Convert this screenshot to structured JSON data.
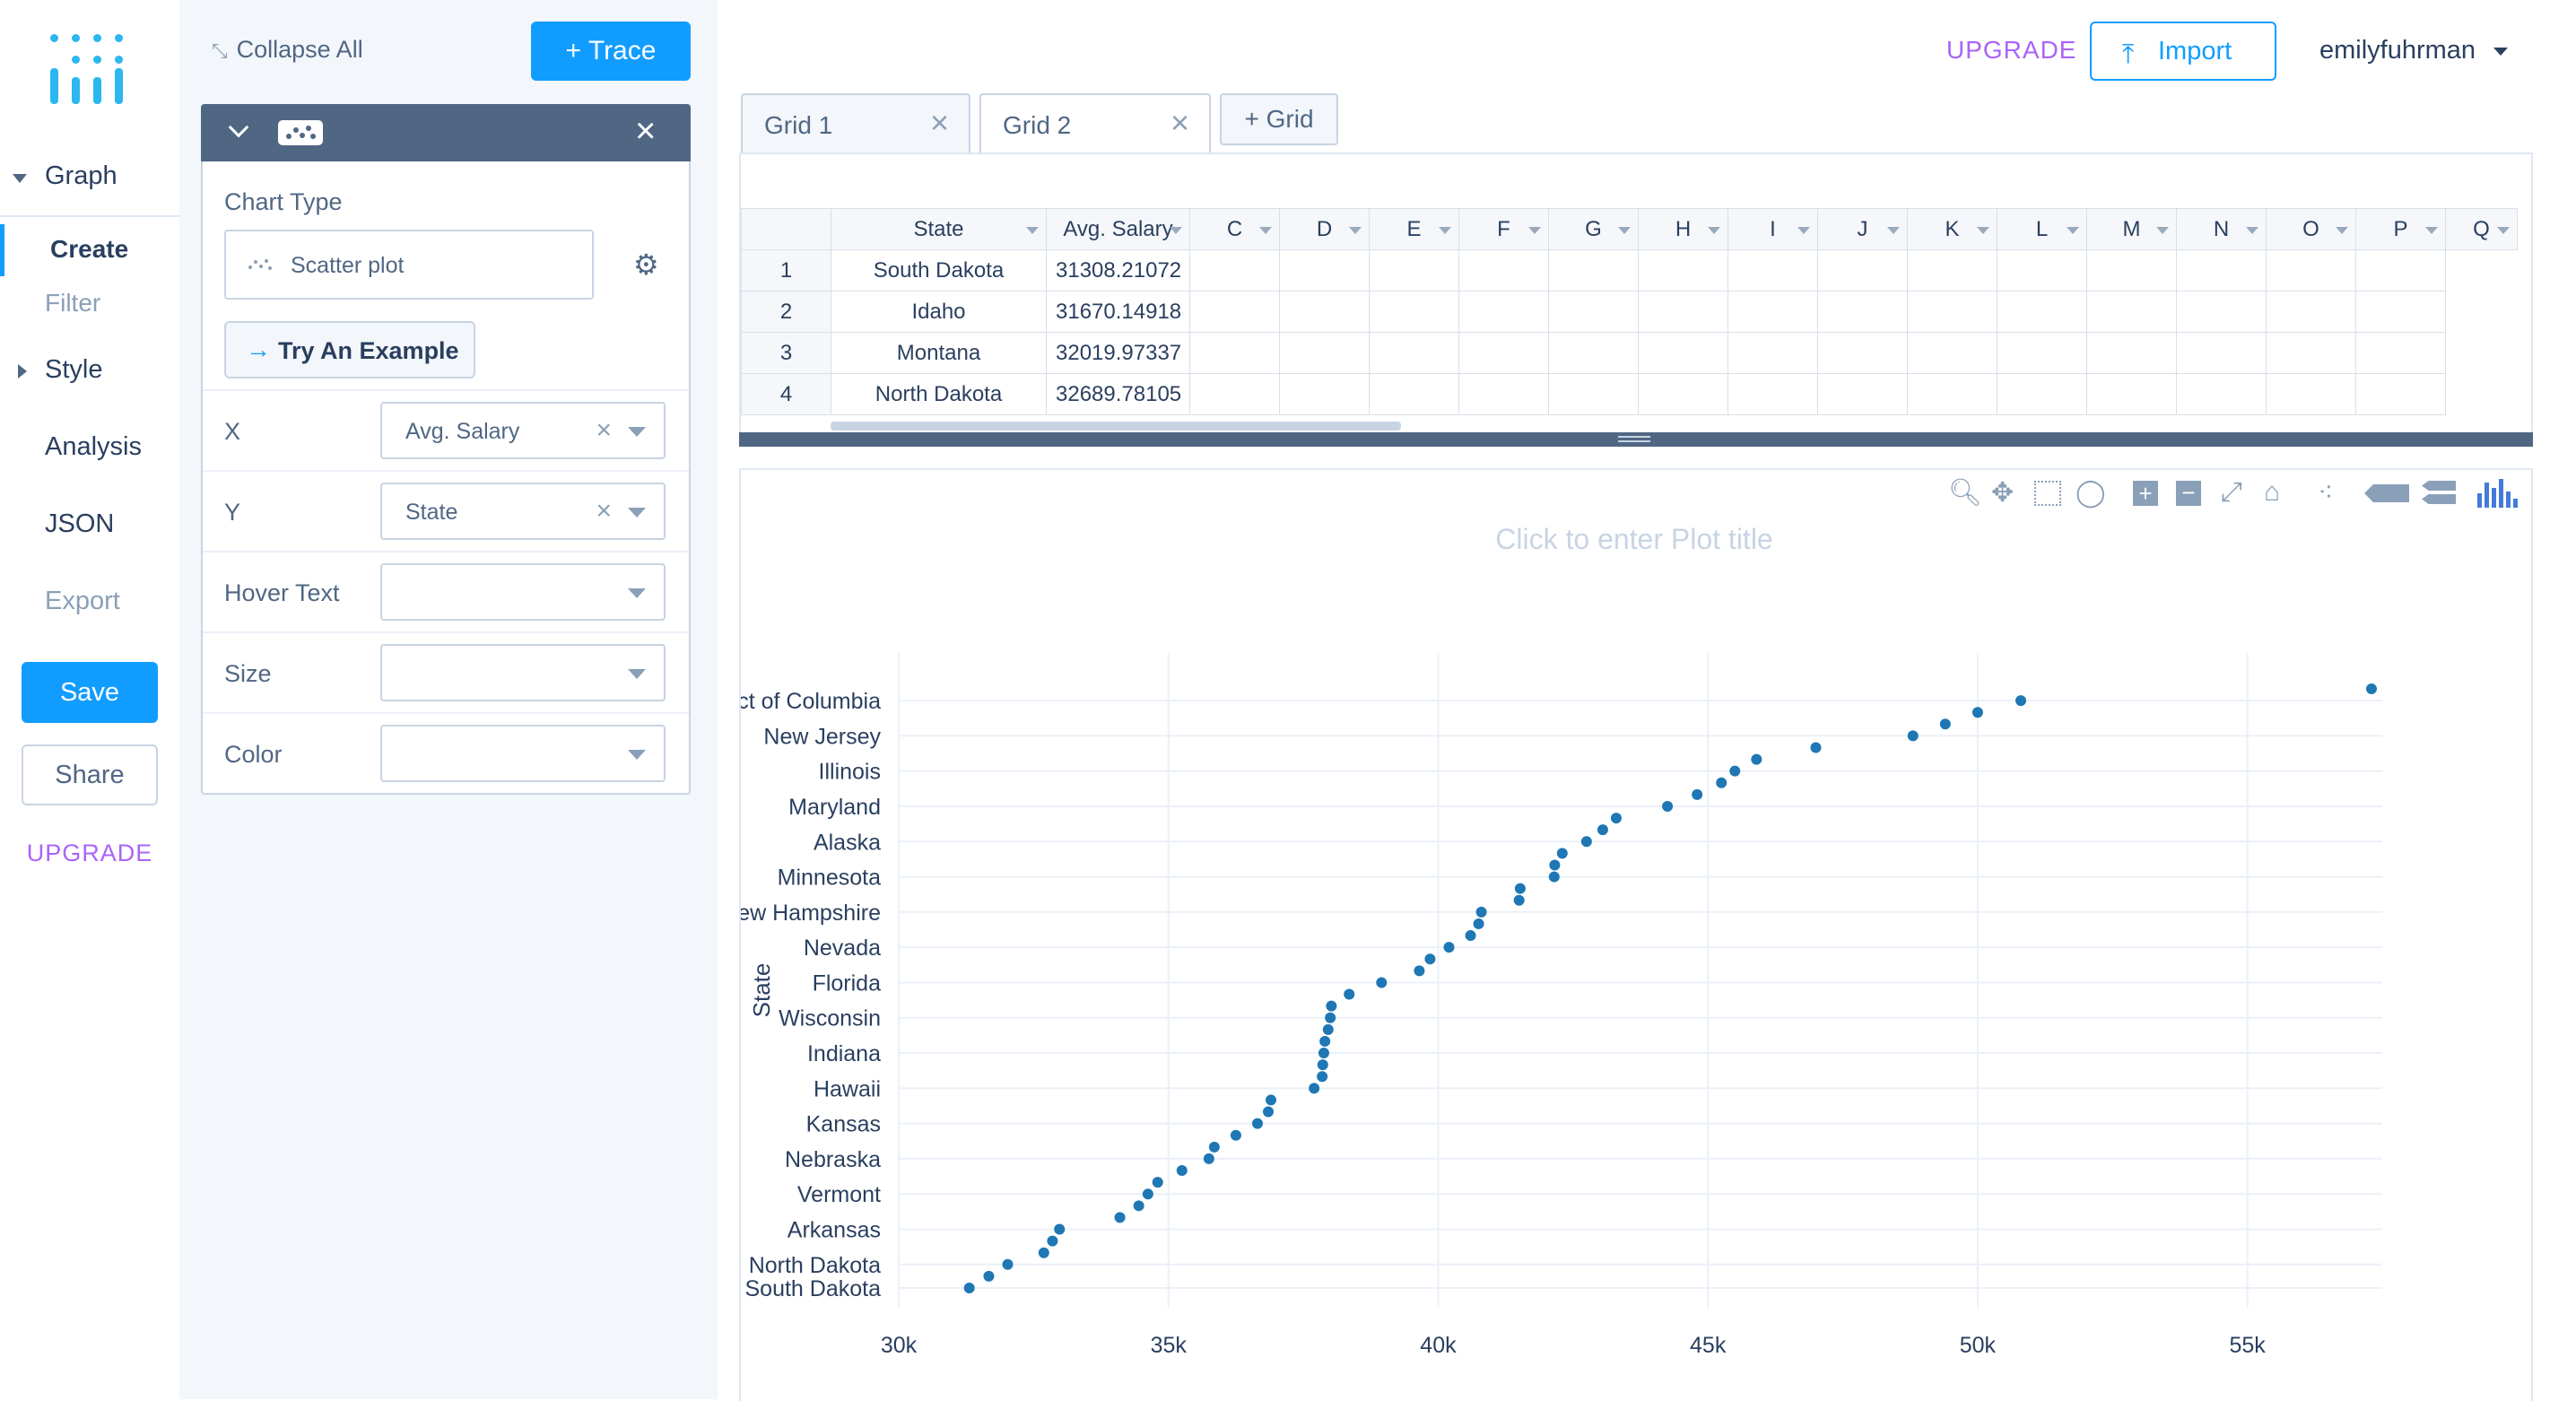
{
  "nav": {
    "graph": "Graph",
    "create": "Create",
    "filter": "Filter",
    "style": "Style",
    "analysis": "Analysis",
    "json": "JSON",
    "export": "Export",
    "save": "Save",
    "share": "Share",
    "upgrade": "UPGRADE"
  },
  "panel": {
    "collapse_all": "Collapse All",
    "add_trace": "+ Trace",
    "chart_type_label": "Chart Type",
    "chart_type_value": "Scatter plot",
    "try_example": "Try An Example",
    "fields": [
      {
        "label": "X",
        "value": "Avg. Salary",
        "clearable": true
      },
      {
        "label": "Y",
        "value": "State",
        "clearable": true
      },
      {
        "label": "Hover Text",
        "value": "",
        "clearable": false
      },
      {
        "label": "Size",
        "value": "",
        "clearable": false
      },
      {
        "label": "Color",
        "value": "",
        "clearable": false
      }
    ]
  },
  "header": {
    "upgrade": "UPGRADE",
    "import": "Import",
    "user": "emilyfuhrman"
  },
  "tabs": [
    {
      "label": "Grid 1",
      "active": false
    },
    {
      "label": "Grid 2",
      "active": true
    }
  ],
  "add_grid": "+ Grid",
  "sheet": {
    "columns": [
      "State",
      "Avg. Salary",
      "C",
      "D",
      "E",
      "F",
      "G",
      "H",
      "I",
      "J",
      "K",
      "L",
      "M",
      "N",
      "O",
      "P",
      "Q"
    ],
    "rows": [
      {
        "n": "1",
        "state": "South Dakota",
        "salary": "31308.21072"
      },
      {
        "n": "2",
        "state": "Idaho",
        "salary": "31670.14918"
      },
      {
        "n": "3",
        "state": "Montana",
        "salary": "32019.97337"
      },
      {
        "n": "4",
        "state": "North Dakota",
        "salary": "32689.78105"
      }
    ]
  },
  "plot": {
    "title_placeholder": "Click to enter Plot title",
    "ylabel": "State"
  },
  "colors": {
    "accent": "#119dff",
    "upgrade": "#ab63fa",
    "panel_bg": "#f3f6fa",
    "trace_header": "#506784",
    "marker": "#1f77b4"
  },
  "chart_data": {
    "type": "scatter",
    "title": "",
    "xlabel": "",
    "ylabel": "State",
    "xlim": [
      30000,
      57500
    ],
    "x_ticks": [
      "30k",
      "35k",
      "40k",
      "45k",
      "50k",
      "55k"
    ],
    "x_tick_values": [
      30000,
      35000,
      40000,
      45000,
      50000,
      55000
    ],
    "y_tick_labels": [
      "ct of Columbia",
      "New Jersey",
      "Illinois",
      "Maryland",
      "Alaska",
      "Minnesota",
      "ew Hampshire",
      "Nevada",
      "Florida",
      "Wisconsin",
      "Indiana",
      "Hawaii",
      "Kansas",
      "Nebraska",
      "Vermont",
      "Arkansas",
      "North Dakota",
      "South Dakota"
    ],
    "y_tick_index": [
      50,
      47,
      44,
      41,
      38,
      35,
      32,
      29,
      26,
      23,
      20,
      17,
      14,
      11,
      8,
      5,
      2,
      0
    ],
    "grid": true,
    "points_salary": [
      31308,
      31670,
      32020,
      32690,
      32850,
      32980,
      34100,
      34450,
      34620,
      34800,
      35250,
      35750,
      35850,
      36250,
      36650,
      36850,
      36900,
      37700,
      37850,
      37860,
      37880,
      37900,
      37960,
      38000,
      38020,
      38350,
      38950,
      39650,
      39850,
      40200,
      40600,
      40750,
      40800,
      41500,
      41520,
      42150,
      42160,
      42300,
      42750,
      43050,
      43300,
      44250,
      44800,
      45250,
      45500,
      45900,
      47000,
      48800,
      49400,
      50000,
      50800,
      57300
    ]
  }
}
